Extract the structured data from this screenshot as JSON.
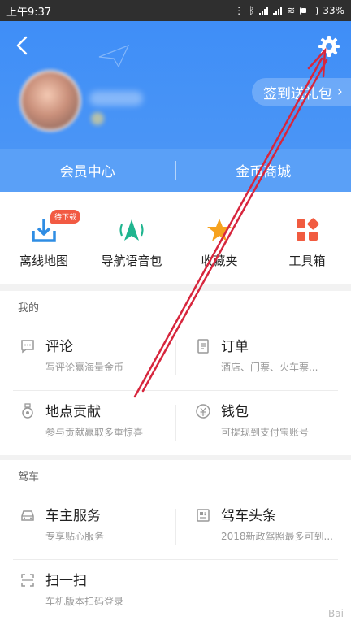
{
  "status": {
    "time": "上午9:37",
    "battery": "33%"
  },
  "header": {
    "checkin_label": "签到送礼包",
    "checkin_chevron": "›"
  },
  "member_bar": {
    "left": "会员中心",
    "right": "金币商城"
  },
  "quick": [
    {
      "label": "离线地图",
      "badge": "待下载",
      "icon": "download-icon",
      "color": "#2f8de4"
    },
    {
      "label": "导航语音包",
      "icon": "nav-voice-icon",
      "color": "#1fb58f"
    },
    {
      "label": "收藏夹",
      "icon": "star-icon",
      "color": "#f6a21e"
    },
    {
      "label": "工具箱",
      "icon": "toolbox-icon",
      "color": "#f15b40"
    }
  ],
  "mine": {
    "title": "我的",
    "items": [
      {
        "title": "评论",
        "sub": "写评论赢海量金币",
        "icon": "comment-icon"
      },
      {
        "title": "订单",
        "sub": "酒店、门票、火车票...",
        "icon": "order-icon"
      },
      {
        "title": "地点贡献",
        "sub": "参与贡献赢取多重惊喜",
        "icon": "medal-icon"
      },
      {
        "title": "钱包",
        "sub": "可提现到支付宝账号",
        "icon": "wallet-icon"
      }
    ]
  },
  "drive": {
    "title": "驾车",
    "items": [
      {
        "title": "车主服务",
        "sub": "专享贴心服务",
        "icon": "car-icon"
      },
      {
        "title": "驾车头条",
        "sub": "2018新政驾照最多可到...",
        "icon": "news-icon"
      },
      {
        "title": "扫一扫",
        "sub": "车机版本扫码登录",
        "icon": "scan-icon"
      }
    ]
  },
  "watermark": "Bai"
}
